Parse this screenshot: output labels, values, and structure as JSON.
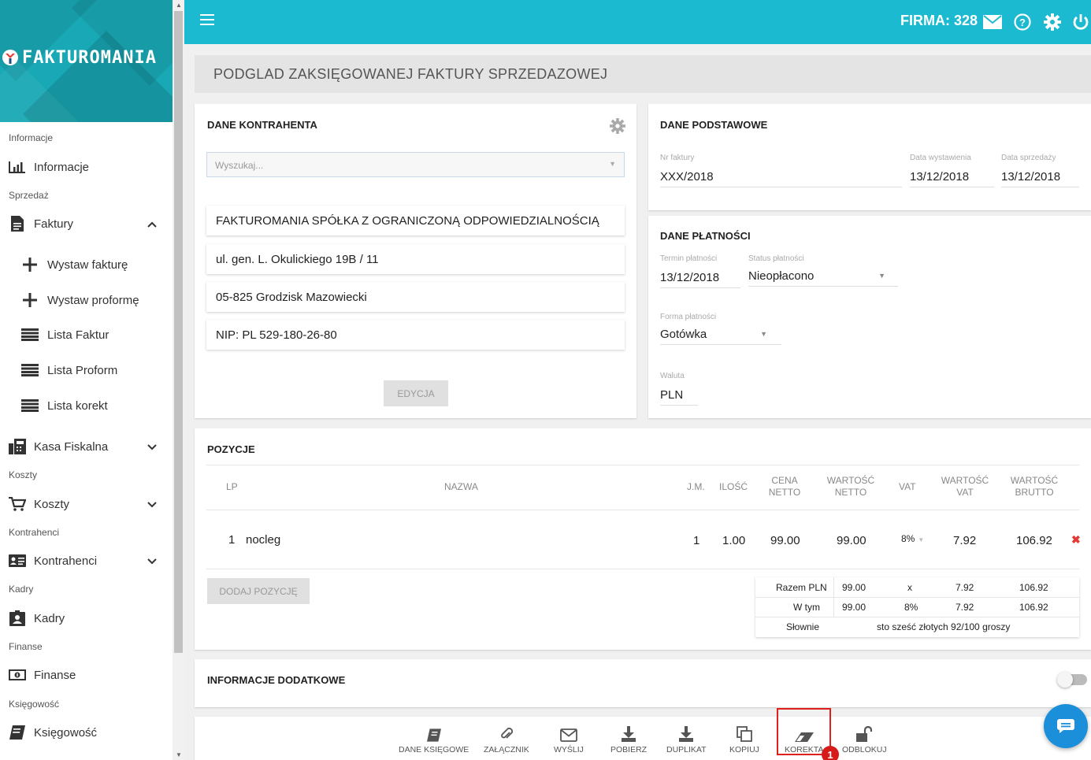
{
  "app": {
    "logo": "FAKTUROMANIA"
  },
  "header": {
    "firma_label": "FIRMA: 328"
  },
  "page_title": "PODGLAD ZAKSIĘGOWANEJ FAKTURY SPRZEDAZOWEJ",
  "sidebar": {
    "sections": {
      "informacje": "Informacje",
      "sprzedaz": "Sprzedaż",
      "koszty": "Koszty",
      "kontrahenci": "Kontrahenci",
      "kadry": "Kadry",
      "finanse": "Finanse",
      "ksiegowosc": "Księgowość"
    },
    "items": {
      "informacje": "Informacje",
      "faktury": "Faktury",
      "wystaw_fakture": "Wystaw fakturę",
      "wystaw_proforme": "Wystaw proformę",
      "lista_faktur": "Lista Faktur",
      "lista_proform": "Lista Proform",
      "lista_korekt": "Lista korekt",
      "kasa_fiskalna": "Kasa Fiskalna",
      "koszty": "Koszty",
      "kontrahenci": "Kontrahenci",
      "kadry": "Kadry",
      "finanse": "Finanse",
      "ksiegowosc": "Księgowość"
    }
  },
  "kontrahent": {
    "title": "DANE KONTRAHENTA",
    "search_placeholder": "Wyszukaj...",
    "name": "FAKTUROMANIA SPÓŁKA Z OGRANICZONĄ ODPOWIEDZIALNOŚCIĄ",
    "street": "ul. gen. L. Okulickiego 19B / 11",
    "city": "05-825 Grodzisk Mazowiecki",
    "nip": "NIP: PL 529-180-26-80",
    "edit_button": "EDYCJA"
  },
  "podstawowe": {
    "title": "DANE PODSTAWOWE",
    "nr_label": "Nr faktury",
    "nr_value": "XXX/2018",
    "wyst_label": "Data wystawienia",
    "wyst_value": "13/12/2018",
    "sprz_label": "Data sprzedaży",
    "sprz_value": "13/12/2018"
  },
  "platnosci": {
    "title": "DANE PŁATNOŚCI",
    "termin_label": "Termin płatności",
    "termin_value": "13/12/2018",
    "status_label": "Status płatności",
    "status_value": "Nieopłacono",
    "forma_label": "Forma płatności",
    "forma_value": "Gotówka",
    "waluta_label": "Waluta",
    "waluta_value": "PLN"
  },
  "pozycje": {
    "title": "POZYCJE",
    "headers": {
      "lp": "LP",
      "nazwa": "NAZWA",
      "jm": "J.M.",
      "ilosc": "ILOŚĆ",
      "cena1": "CENA",
      "cena2": "NETTO",
      "wn1": "WARTOŚĆ",
      "wn2": "NETTO",
      "vat": "VAT",
      "wv1": "WARTOŚĆ",
      "wv2": "VAT",
      "wb1": "WARTOŚĆ",
      "wb2": "BRUTTO"
    },
    "rows": [
      {
        "lp": "1",
        "nazwa": "nocleg",
        "jm": "1",
        "ilosc": "1.00",
        "cena": "99.00",
        "netto": "99.00",
        "vat": "8%",
        "wvat": "7.92",
        "brutto": "106.92"
      }
    ],
    "add_button": "DODAJ POZYCJĘ",
    "summary": {
      "razem_label": "Razem PLN",
      "razem_netto": "99.00",
      "razem_vat": "x",
      "razem_wvat": "7.92",
      "razem_brutto": "106.92",
      "wtym_label": "W tym",
      "wtym_netto": "99.00",
      "wtym_vat": "8%",
      "wtym_wvat": "7.92",
      "wtym_brutto": "106.92",
      "slownie_label": "Słownie",
      "slownie_value": "sto sześć złotych 92/100 groszy"
    }
  },
  "dodatkowe": {
    "title": "INFORMACJE DODATKOWE"
  },
  "actions": {
    "dane_ksiegowe": "DANE KSIĘGOWE",
    "zalacznik": "ZAŁĄCZNIK",
    "wyslij": "WYŚLIJ",
    "pobierz": "POBIERZ",
    "duplikat": "DUPLIKAT",
    "kopiuj": "KOPIUJ",
    "korekta": "KOREKTA",
    "odblokuj": "ODBLOKUJ"
  },
  "annotation": {
    "badge": "1"
  },
  "colors": {
    "topbar": "#1bbad0",
    "logo_bg": "#19a9b6",
    "highlight": "#e0201c",
    "delete": "#e53935",
    "chat": "#1b8fd9"
  }
}
